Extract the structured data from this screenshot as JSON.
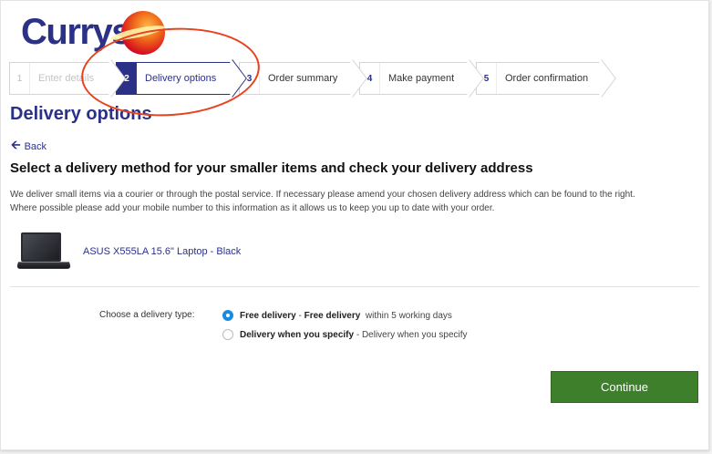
{
  "brand": {
    "logo_text": "Currys"
  },
  "steps": [
    {
      "number": "1",
      "label": "Enter details",
      "state": "disabled"
    },
    {
      "number": "2",
      "label": "Delivery options",
      "state": "active"
    },
    {
      "number": "3",
      "label": "Order summary",
      "state": "upcoming"
    },
    {
      "number": "4",
      "label": "Make payment",
      "state": "upcoming"
    },
    {
      "number": "5",
      "label": "Order confirmation",
      "state": "upcoming"
    }
  ],
  "page": {
    "title": "Delivery options",
    "back_label": "Back",
    "section_title": "Select a delivery method for your smaller items and check your delivery address",
    "intro_line1": "We deliver small items via a courier or through the postal service. If necessary please amend your chosen delivery address which can be found to the right.",
    "intro_line2": "Where possible please add your mobile number to this information as it allows us to keep you up to date with your order."
  },
  "product": {
    "name": "ASUS X555LA 15.6\" Laptop - Black"
  },
  "delivery": {
    "label": "Choose a delivery type:",
    "options": [
      {
        "title": "Free delivery",
        "detail": " - ",
        "detail_bold": "Free delivery",
        "suffix": "  within 5 working days",
        "selected": true
      },
      {
        "title": "Delivery when you specify",
        "detail": " - Delivery when you specify",
        "selected": false
      }
    ]
  },
  "actions": {
    "continue_label": "Continue"
  },
  "colors": {
    "brand": "#2b3187",
    "accent": "#e8421f",
    "continue": "#3e7f2c",
    "radio": "#1a8ce0"
  }
}
